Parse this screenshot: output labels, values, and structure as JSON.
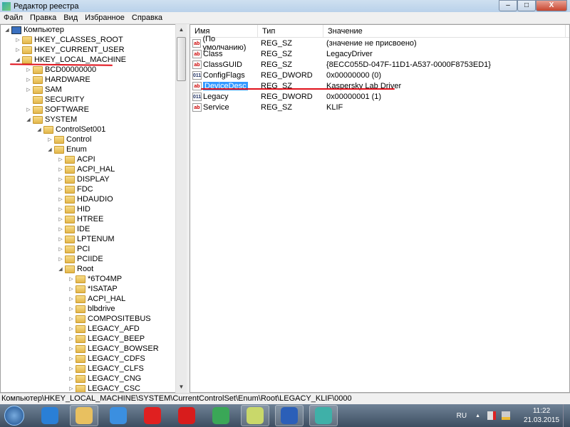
{
  "window": {
    "title": "Редактор реестра",
    "minimize": "–",
    "maximize": "□",
    "close": "X"
  },
  "menu": [
    "Файл",
    "Правка",
    "Вид",
    "Избранное",
    "Справка"
  ],
  "tree": [
    {
      "label": "Компьютер",
      "level": 0,
      "state": "expanded",
      "icon": "computer-icon"
    },
    {
      "label": "HKEY_CLASSES_ROOT",
      "level": 1,
      "state": "collapsed"
    },
    {
      "label": "HKEY_CURRENT_USER",
      "level": 1,
      "state": "collapsed"
    },
    {
      "label": "HKEY_LOCAL_MACHINE",
      "level": 1,
      "state": "expanded"
    },
    {
      "label": "BCD00000000",
      "level": 2,
      "state": "collapsed"
    },
    {
      "label": "HARDWARE",
      "level": 2,
      "state": "collapsed"
    },
    {
      "label": "SAM",
      "level": 2,
      "state": "collapsed"
    },
    {
      "label": "SECURITY",
      "level": 2,
      "state": "none"
    },
    {
      "label": "SOFTWARE",
      "level": 2,
      "state": "collapsed"
    },
    {
      "label": "SYSTEM",
      "level": 2,
      "state": "expanded"
    },
    {
      "label": "ControlSet001",
      "level": 3,
      "state": "expanded"
    },
    {
      "label": "Control",
      "level": 4,
      "state": "collapsed"
    },
    {
      "label": "Enum",
      "level": 4,
      "state": "expanded"
    },
    {
      "label": "ACPI",
      "level": 5,
      "state": "collapsed"
    },
    {
      "label": "ACPI_HAL",
      "level": 5,
      "state": "collapsed"
    },
    {
      "label": "DISPLAY",
      "level": 5,
      "state": "collapsed"
    },
    {
      "label": "FDC",
      "level": 5,
      "state": "collapsed"
    },
    {
      "label": "HDAUDIO",
      "level": 5,
      "state": "collapsed"
    },
    {
      "label": "HID",
      "level": 5,
      "state": "collapsed"
    },
    {
      "label": "HTREE",
      "level": 5,
      "state": "collapsed"
    },
    {
      "label": "IDE",
      "level": 5,
      "state": "collapsed"
    },
    {
      "label": "LPTENUM",
      "level": 5,
      "state": "collapsed"
    },
    {
      "label": "PCI",
      "level": 5,
      "state": "collapsed"
    },
    {
      "label": "PCIIDE",
      "level": 5,
      "state": "collapsed"
    },
    {
      "label": "Root",
      "level": 5,
      "state": "expanded"
    },
    {
      "label": "*6TO4MP",
      "level": 6,
      "state": "collapsed"
    },
    {
      "label": "*ISATAP",
      "level": 6,
      "state": "collapsed"
    },
    {
      "label": "ACPI_HAL",
      "level": 6,
      "state": "collapsed"
    },
    {
      "label": "blbdrive",
      "level": 6,
      "state": "collapsed"
    },
    {
      "label": "COMPOSITEBUS",
      "level": 6,
      "state": "collapsed"
    },
    {
      "label": "LEGACY_AFD",
      "level": 6,
      "state": "collapsed"
    },
    {
      "label": "LEGACY_BEEP",
      "level": 6,
      "state": "collapsed"
    },
    {
      "label": "LEGACY_BOWSER",
      "level": 6,
      "state": "collapsed"
    },
    {
      "label": "LEGACY_CDFS",
      "level": 6,
      "state": "collapsed"
    },
    {
      "label": "LEGACY_CLFS",
      "level": 6,
      "state": "collapsed"
    },
    {
      "label": "LEGACY_CNG",
      "level": 6,
      "state": "collapsed"
    },
    {
      "label": "LEGACY_CSC",
      "level": 6,
      "state": "collapsed"
    }
  ],
  "values": {
    "headers": [
      "Имя",
      "Тип",
      "Значение"
    ],
    "rows": [
      {
        "name": "(По умолчанию)",
        "type": "REG_SZ",
        "value": "(значение не присвоено)",
        "icon": "ab"
      },
      {
        "name": "Class",
        "type": "REG_SZ",
        "value": "LegacyDriver",
        "icon": "ab"
      },
      {
        "name": "ClassGUID",
        "type": "REG_SZ",
        "value": "{8ECC055D-047F-11D1-A537-0000F8753ED1}",
        "icon": "ab"
      },
      {
        "name": "ConfigFlags",
        "type": "REG_DWORD",
        "value": "0x00000000 (0)",
        "icon": "011"
      },
      {
        "name": "DeviceDesc",
        "type": "REG_SZ",
        "value": "Kaspersky Lab Driver",
        "icon": "ab",
        "selected": true
      },
      {
        "name": "Legacy",
        "type": "REG_DWORD",
        "value": "0x00000001 (1)",
        "icon": "011"
      },
      {
        "name": "Service",
        "type": "REG_SZ",
        "value": "KLIF",
        "icon": "ab"
      }
    ]
  },
  "status": "Компьютер\\HKEY_LOCAL_MACHINE\\SYSTEM\\CurrentControlSet\\Enum\\Root\\LEGACY_KLIF\\0000",
  "taskbar": {
    "apps": [
      {
        "name": "internet-explorer",
        "color": "#2a7fd6"
      },
      {
        "name": "file-explorer",
        "color": "#e8c060"
      },
      {
        "name": "media-player",
        "color": "#3b8fe0"
      },
      {
        "name": "yandex-browser",
        "color": "#e02020"
      },
      {
        "name": "yandex",
        "color": "#d81c1c"
      },
      {
        "name": "chrome",
        "color": "#3aa757"
      },
      {
        "name": "sticky-notes",
        "color": "#c9d86a"
      },
      {
        "name": "word",
        "color": "#2b5fb8"
      },
      {
        "name": "regedit",
        "color": "#3fb0a8"
      }
    ],
    "lang": "RU",
    "time": "11:22",
    "date": "21.03.2015"
  },
  "annotation_color": "#e0101a"
}
